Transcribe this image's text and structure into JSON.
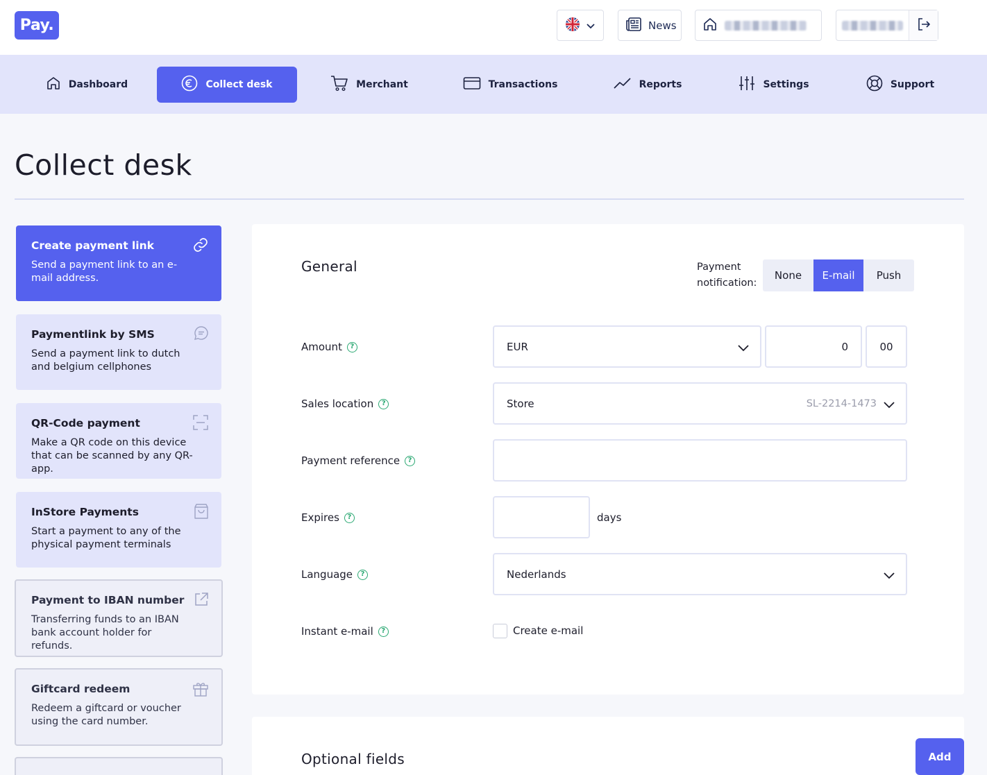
{
  "header": {
    "logo_text": "Pay.",
    "news_label": "News"
  },
  "nav": {
    "items": [
      {
        "label": "Dashboard",
        "icon": "home-icon"
      },
      {
        "label": "Collect desk",
        "icon": "euro-icon"
      },
      {
        "label": "Merchant",
        "icon": "cart-icon"
      },
      {
        "label": "Transactions",
        "icon": "card-icon"
      },
      {
        "label": "Reports",
        "icon": "chart-line-icon"
      },
      {
        "label": "Settings",
        "icon": "sliders-icon"
      },
      {
        "label": "Support",
        "icon": "lifebuoy-icon"
      }
    ],
    "active": "Collect desk"
  },
  "page": {
    "title": "Collect desk"
  },
  "cards": [
    {
      "title": "Create payment link",
      "desc": "Send a payment link to an e-mail address.",
      "icon": "link-icon"
    },
    {
      "title": "Paymentlink by SMS",
      "desc": "Send a payment link to dutch and belgium cellphones",
      "icon": "chat-icon"
    },
    {
      "title": "QR-Code payment",
      "desc": "Make a QR code on this device that can be scanned by any QR-app.",
      "icon": "qr-scan-icon"
    },
    {
      "title": "InStore Payments",
      "desc": "Start a payment to any of the physical payment terminals",
      "icon": "bag-icon"
    },
    {
      "title": "Payment to IBAN number",
      "desc": "Transferring funds to an IBAN bank account holder for refunds.",
      "icon": "external-link-icon"
    },
    {
      "title": "Giftcard redeem",
      "desc": "Redeem a giftcard or voucher using the card number.",
      "icon": "gift-icon"
    }
  ],
  "form": {
    "section_title": "General",
    "notification": {
      "label_line1": "Payment",
      "label_line2": "notification:",
      "options": [
        "None",
        "E-mail",
        "Push"
      ],
      "selected": "E-mail"
    },
    "amount": {
      "label": "Amount",
      "currency": "EUR",
      "whole": "0",
      "cents": "00"
    },
    "sales_location": {
      "label": "Sales location",
      "value": "Store",
      "code": "SL-2214-1473"
    },
    "payment_reference": {
      "label": "Payment reference",
      "value": ""
    },
    "expires": {
      "label": "Expires",
      "value": "",
      "unit": "days"
    },
    "language": {
      "label": "Language",
      "value": "Nederlands"
    },
    "instant_email": {
      "label": "Instant e-mail",
      "checkbox_label": "Create e-mail",
      "checked": false
    },
    "help_glyph": "?"
  },
  "optional": {
    "section_title": "Optional fields",
    "add_label": "Add"
  },
  "colors": {
    "primary": "#5561ee",
    "nav_bg": "#e2e4fb",
    "help_green": "#2aa872"
  }
}
